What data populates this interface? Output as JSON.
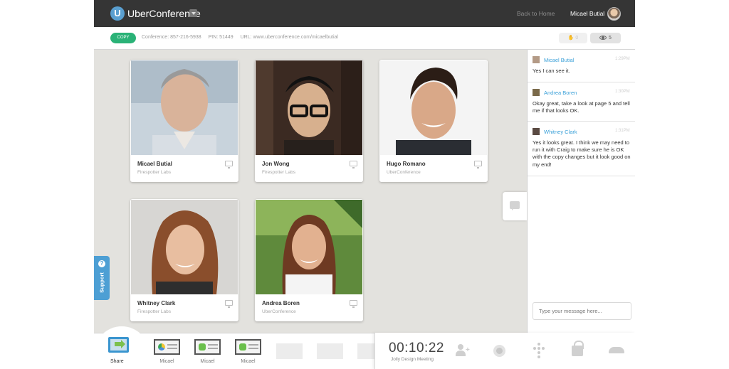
{
  "header": {
    "brand": "UberConference",
    "logo_letter": "U",
    "back_link": "Back to Home",
    "user_name": "Micael Butial"
  },
  "infobar": {
    "copy_label": "COPY",
    "conference": "Conference: 857-216-5938",
    "pin": "PIN: 51449",
    "url": "URL: www.uberconference.com/micaelbutial",
    "hand_count": "0",
    "viewer_count": "5"
  },
  "participants": [
    {
      "name": "Micael Butial",
      "org": "Firespotter Labs"
    },
    {
      "name": "Jon Wong",
      "org": "Firespotter Labs"
    },
    {
      "name": "Hugo Romano",
      "org": "UberConference"
    },
    {
      "name": "Whitney Clark",
      "org": "Firespotter Labs"
    },
    {
      "name": "Andrea Boren",
      "org": "UberConference"
    }
  ],
  "support": {
    "label": "Support",
    "icon_text": "?"
  },
  "chat": {
    "messages": [
      {
        "name": "Micael Butial",
        "time": "1:29PM",
        "text": "Yes I can see it."
      },
      {
        "name": "Andrea Boren",
        "time": "1:30PM",
        "text": "Okay great, take a look at page 5 and tell me if that looks OK."
      },
      {
        "name": "Whitney Clark",
        "time": "1:31PM",
        "text": "Yes it looks great. I think we may need to run it with Craig to make sure he is OK with the copy changes but it look good on my end!"
      }
    ],
    "input_placeholder": "Type your message here..."
  },
  "bottom": {
    "share_label": "Share",
    "thumbs": [
      {
        "label": "Micael",
        "icon": "google-drive-icon",
        "color": "#4a90d9"
      },
      {
        "label": "Micael",
        "icon": "evernote-icon",
        "color": "#6abf4b"
      },
      {
        "label": "Micael",
        "icon": "evernote-icon",
        "color": "#6abf4b"
      }
    ],
    "timer": "00:10:22",
    "meeting_name": "Jolly Design Meeting"
  }
}
